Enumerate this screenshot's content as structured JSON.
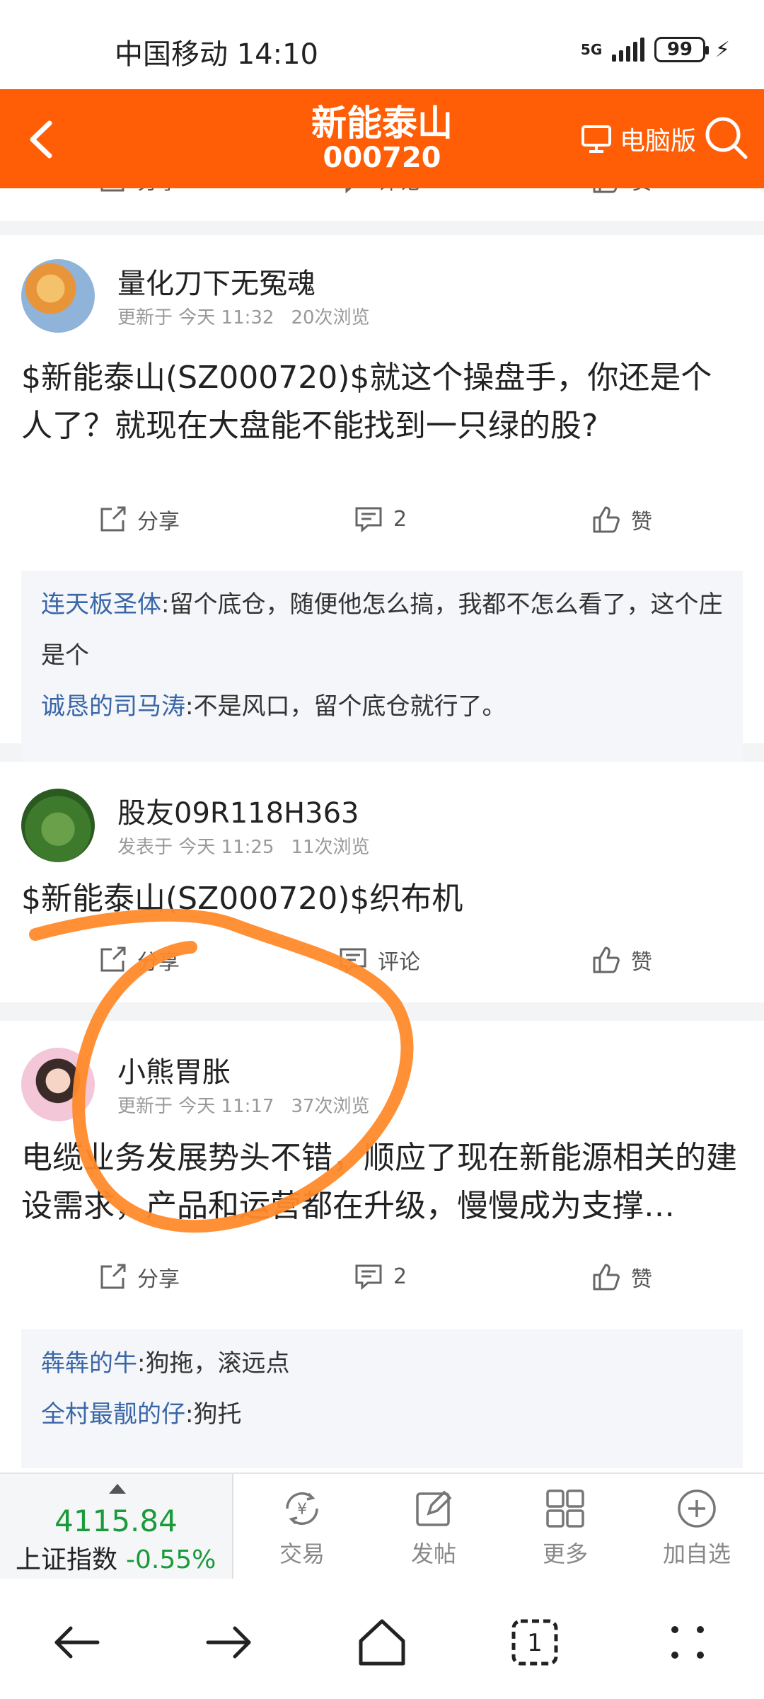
{
  "status": {
    "carrier_time": "中国移动 14:10",
    "network": "5G",
    "battery": "99"
  },
  "header": {
    "title": "新能泰山",
    "code": "000720",
    "pc_label": "电脑版"
  },
  "posts": [
    {
      "user": "量化刀下无冤魂",
      "time_label": "更新于 今天 11:32",
      "views": "20次浏览",
      "text": "$新能泰山(SZ000720)$就这个操盘手，你还是个人了？就现在大盘能不能找到一只绿的股?",
      "share": "分享",
      "comment_count": "2",
      "like": "赞",
      "comments": [
        {
          "user": "连天板圣体",
          "text": ":留个底仓，随便他怎么搞，我都不怎么看了，这个庄是个"
        },
        {
          "user": "诚恳的司马涛",
          "text": ":不是风口，留个底仓就行了。"
        }
      ]
    },
    {
      "user": "股友09R118H363",
      "time_label": "发表于 今天 11:25",
      "views": "11次浏览",
      "text": "$新能泰山(SZ000720)$织布机",
      "share": "分享",
      "comment_label": "评论",
      "like": "赞"
    },
    {
      "user": "小熊胃胀",
      "time_label": "更新于 今天 11:17",
      "views": "37次浏览",
      "text": "电缆业务发展势头不错，顺应了现在新能源相关的建设需求，产品和运营都在升级，慢慢成为支撑…",
      "share": "分享",
      "comment_count": "2",
      "like": "赞",
      "comments": [
        {
          "user": "犇犇的牛",
          "text": ":狗拖，滚远点"
        },
        {
          "user": "全村最靓的仔",
          "text": ":狗托"
        }
      ]
    }
  ],
  "partial_top": {
    "share": "分享",
    "comment": "评论",
    "like": "赞"
  },
  "toolbar": {
    "index_value": "4115.84",
    "index_name": "上证指数",
    "index_change": "-0.55%",
    "trade": "交易",
    "post": "发帖",
    "more": "更多",
    "watch": "加自选"
  },
  "colors": {
    "brand": "#ff5e06",
    "down_green": "#1a9a3a",
    "link_blue": "#3a66a8",
    "annotation": "#ff8a2b"
  }
}
